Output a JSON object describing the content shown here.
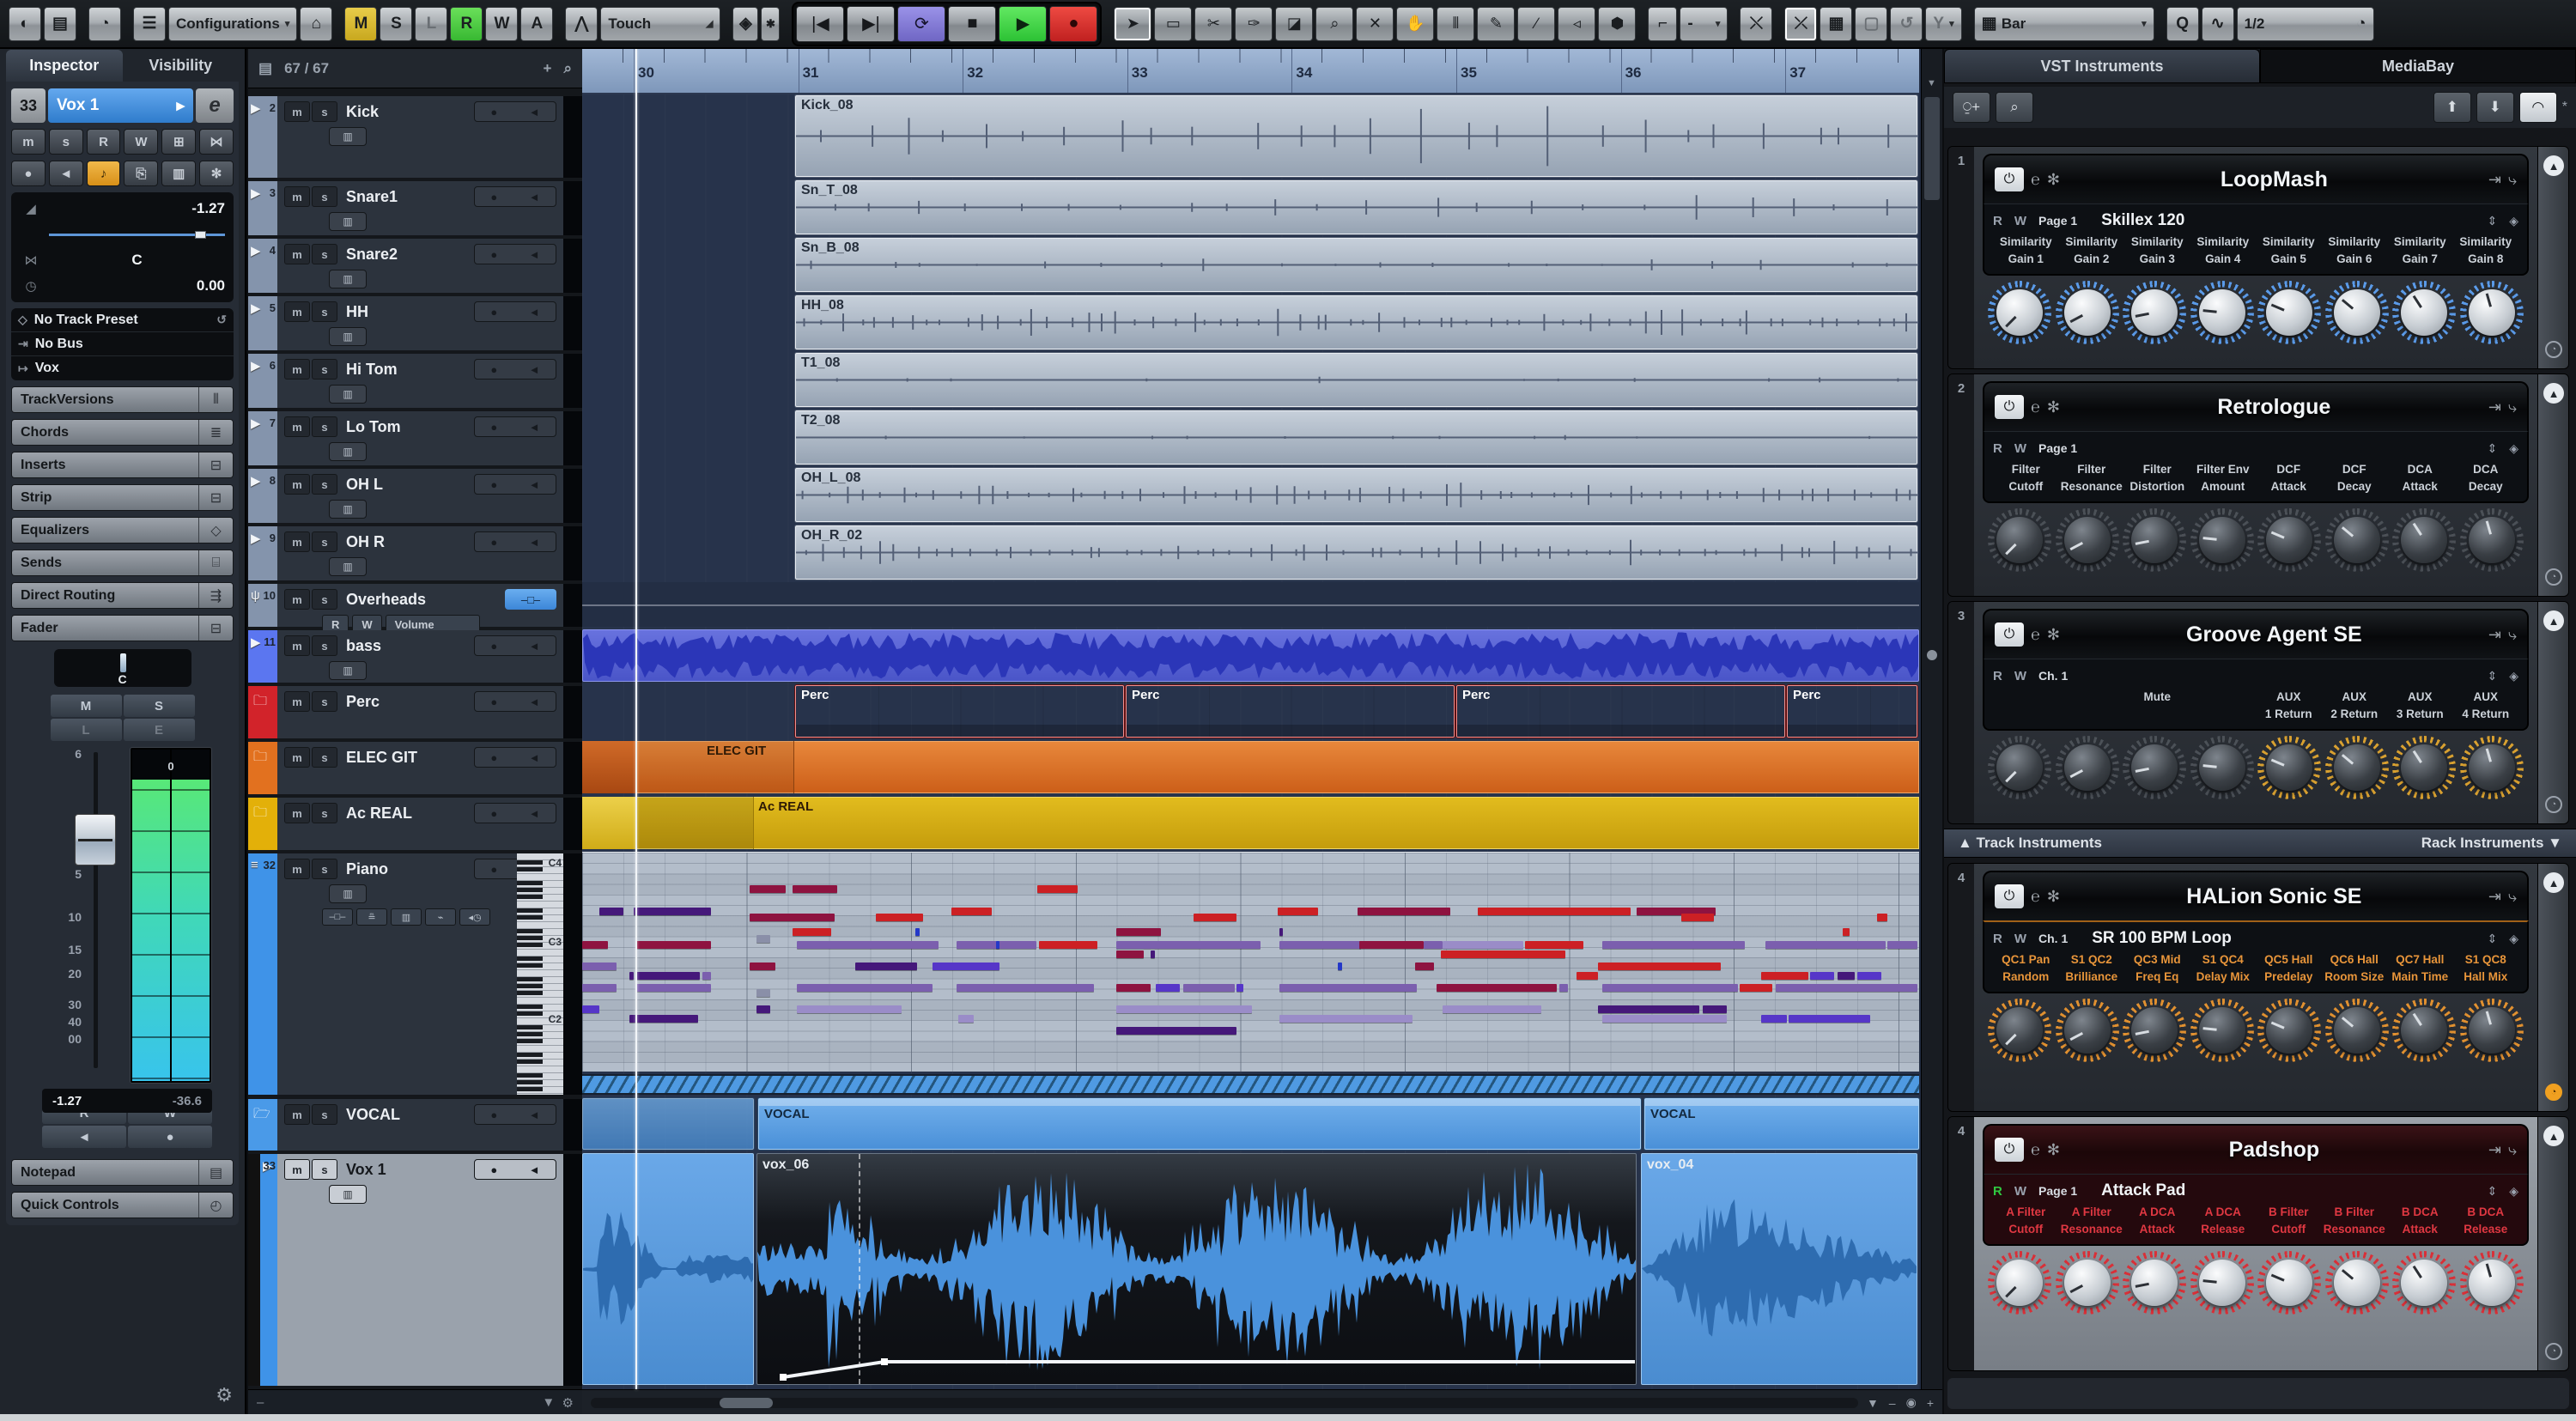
{
  "toolbar": {
    "configurations": "Configurations",
    "automation_mode": "Touch",
    "state_letters": [
      "M",
      "S",
      "L",
      "R",
      "W",
      "A"
    ],
    "grid_label": "Bar",
    "q_label": "Q",
    "quantize_label": "1/2",
    "snap_value": "-",
    "tools": [
      {
        "name": "object-selection",
        "glyph": "➤"
      },
      {
        "name": "range-selection",
        "glyph": "▭"
      },
      {
        "name": "split",
        "glyph": "✂"
      },
      {
        "name": "glue",
        "glyph": "✑"
      },
      {
        "name": "erase",
        "glyph": "◪"
      },
      {
        "name": "zoom",
        "glyph": "⌕"
      },
      {
        "name": "mute",
        "glyph": "✕"
      },
      {
        "name": "time-warp",
        "glyph": "✋"
      },
      {
        "name": "comp",
        "glyph": "⫴"
      },
      {
        "name": "draw",
        "glyph": "✎"
      },
      {
        "name": "line",
        "glyph": "∕"
      },
      {
        "name": "audition",
        "glyph": "◃"
      },
      {
        "name": "color",
        "glyph": "⬢"
      }
    ]
  },
  "inspector": {
    "tabs": [
      "Inspector",
      "Visibility"
    ],
    "track_number": "33",
    "track_name": "Vox 1",
    "edit_button": "e",
    "mute": "m",
    "solo": "s",
    "read": "R",
    "write": "W",
    "volume": "-1.27",
    "pan": "C",
    "delay": "0.00",
    "preset": "No Track Preset",
    "input": "No Bus",
    "output": "Vox",
    "sections": [
      {
        "label": "TrackVersions",
        "icon": "⫴"
      },
      {
        "label": "Chords",
        "icon": "≣"
      },
      {
        "label": "Inserts",
        "icon": "⊟"
      },
      {
        "label": "Strip",
        "icon": "⊟"
      },
      {
        "label": "Equalizers",
        "icon": "◇"
      },
      {
        "label": "Sends",
        "icon": "⌸"
      },
      {
        "label": "Direct Routing",
        "icon": "⇶"
      },
      {
        "label": "Fader",
        "icon": "⊟"
      }
    ],
    "fader": {
      "scale": [
        "6",
        "0",
        "5",
        "10",
        "15",
        "20",
        "30",
        "40",
        "00"
      ],
      "peak": "0",
      "value": "-1.27",
      "meter_value": "-36.6",
      "m": "M",
      "s": "S",
      "l": "L",
      "e": "E",
      "r": "R",
      "w": "W"
    },
    "bottom_sections": [
      {
        "label": "Notepad",
        "icon": "▤"
      },
      {
        "label": "Quick Controls",
        "icon": "◴"
      }
    ]
  },
  "track_list": {
    "count": "67 / 67",
    "m": "m",
    "s": "s",
    "tracks": [
      {
        "num": "2",
        "name": "Kick",
        "kind": "audio"
      },
      {
        "num": "3",
        "name": "Snare1",
        "kind": "audio"
      },
      {
        "num": "4",
        "name": "Snare2",
        "kind": "audio"
      },
      {
        "num": "5",
        "name": "HH",
        "kind": "audio"
      },
      {
        "num": "6",
        "name": "Hi Tom",
        "kind": "audio"
      },
      {
        "num": "7",
        "name": "Lo Tom",
        "kind": "audio"
      },
      {
        "num": "8",
        "name": "OH L",
        "kind": "audio"
      },
      {
        "num": "9",
        "name": "OH R",
        "kind": "audio"
      },
      {
        "num": "10",
        "name": "Overheads",
        "kind": "group",
        "automation": {
          "r": "R",
          "w": "W",
          "param": "Volume"
        }
      },
      {
        "num": "11",
        "name": "bass",
        "kind": "audio-blue"
      },
      {
        "num": "",
        "name": "Perc",
        "kind": "folder",
        "color": "#d2232a"
      },
      {
        "num": "",
        "name": "ELEC GIT",
        "kind": "folder",
        "color": "#e2711f"
      },
      {
        "num": "",
        "name": "Ac REAL",
        "kind": "folder",
        "color": "#e3b009"
      },
      {
        "num": "32",
        "name": "Piano",
        "kind": "instrument",
        "keys": [
          "C4",
          "C3",
          "C2"
        ]
      },
      {
        "num": "",
        "name": "VOCAL",
        "kind": "folder-open",
        "color": "#4a9ae8"
      },
      {
        "num": "33",
        "name": "Vox 1",
        "kind": "audio-selected"
      }
    ]
  },
  "arrange": {
    "bars": [
      "30",
      "31",
      "32",
      "33",
      "34",
      "35",
      "36",
      "37"
    ],
    "drum_events": [
      "Kick_08",
      "Sn_T_08",
      "Sn_B_08",
      "HH_08",
      "T1_08",
      "T2_08",
      "OH_L_08",
      "OH_R_02"
    ],
    "perc_events": [
      "Perc",
      "Perc",
      "Perc",
      "Perc"
    ],
    "elec_event": "ELEC GIT",
    "ac_event": "Ac REAL",
    "vocal_events": [
      "VOCAL",
      "VOCAL"
    ],
    "vox_events": [
      "vox_06",
      "vox_04"
    ],
    "midi_notes": [
      [
        195,
        38,
        42,
        "m"
      ],
      [
        245,
        38,
        52,
        "m"
      ],
      [
        530,
        38,
        47,
        "r"
      ],
      [
        20,
        64,
        28,
        "d"
      ],
      [
        60,
        64,
        90,
        "d"
      ],
      [
        430,
        64,
        47,
        "r"
      ],
      [
        810,
        64,
        47,
        "r"
      ],
      [
        903,
        64,
        108,
        "m"
      ],
      [
        1043,
        64,
        178,
        "r"
      ],
      [
        1228,
        64,
        92,
        "m"
      ],
      [
        195,
        71,
        99,
        "m"
      ],
      [
        342,
        71,
        55,
        "r"
      ],
      [
        712,
        71,
        50,
        "r"
      ],
      [
        1280,
        71,
        38,
        "r"
      ],
      [
        1508,
        71,
        12,
        "r"
      ],
      [
        245,
        88,
        45,
        "r"
      ],
      [
        388,
        88,
        5,
        "b"
      ],
      [
        622,
        88,
        52,
        "m"
      ],
      [
        812,
        88,
        4,
        "d"
      ],
      [
        1468,
        88,
        8,
        "r"
      ],
      [
        203,
        96,
        16,
        "g"
      ],
      [
        0,
        103,
        30,
        "m"
      ],
      [
        62,
        103,
        88,
        "m"
      ],
      [
        250,
        103,
        165,
        "p"
      ],
      [
        436,
        103,
        93,
        "p"
      ],
      [
        482,
        103,
        4,
        "b"
      ],
      [
        532,
        103,
        68,
        "r"
      ],
      [
        622,
        103,
        168,
        "p"
      ],
      [
        812,
        103,
        95,
        "p"
      ],
      [
        905,
        103,
        75,
        "m"
      ],
      [
        980,
        103,
        22,
        "p"
      ],
      [
        1002,
        103,
        94,
        "lv"
      ],
      [
        1098,
        103,
        68,
        "r"
      ],
      [
        1188,
        103,
        166,
        "p"
      ],
      [
        1378,
        103,
        140,
        "p"
      ],
      [
        1520,
        103,
        35,
        "p"
      ],
      [
        622,
        114,
        32,
        "m"
      ],
      [
        662,
        114,
        5,
        "d"
      ],
      [
        1000,
        114,
        145,
        "r"
      ],
      [
        0,
        128,
        40,
        "p"
      ],
      [
        195,
        128,
        30,
        "m"
      ],
      [
        318,
        128,
        72,
        "d"
      ],
      [
        408,
        128,
        78,
        "v"
      ],
      [
        880,
        128,
        5,
        "b"
      ],
      [
        970,
        128,
        22,
        "m"
      ],
      [
        1183,
        128,
        143,
        "r"
      ],
      [
        55,
        139,
        5,
        "d"
      ],
      [
        62,
        139,
        75,
        "d"
      ],
      [
        140,
        139,
        10,
        "p"
      ],
      [
        1158,
        139,
        25,
        "r"
      ],
      [
        1373,
        139,
        55,
        "r"
      ],
      [
        1430,
        139,
        28,
        "v"
      ],
      [
        1462,
        139,
        20,
        "d"
      ],
      [
        1485,
        139,
        28,
        "v"
      ],
      [
        0,
        153,
        40,
        "p"
      ],
      [
        62,
        153,
        88,
        "p"
      ],
      [
        250,
        153,
        158,
        "p"
      ],
      [
        436,
        153,
        160,
        "p"
      ],
      [
        622,
        153,
        40,
        "m"
      ],
      [
        668,
        153,
        28,
        "v"
      ],
      [
        700,
        153,
        60,
        "p"
      ],
      [
        762,
        153,
        8,
        "v"
      ],
      [
        812,
        153,
        160,
        "p"
      ],
      [
        995,
        153,
        140,
        "m"
      ],
      [
        1138,
        153,
        10,
        "p"
      ],
      [
        1188,
        153,
        158,
        "p"
      ],
      [
        1348,
        153,
        38,
        "r"
      ],
      [
        1390,
        153,
        165,
        "p"
      ],
      [
        203,
        159,
        16,
        "g"
      ],
      [
        0,
        178,
        20,
        "v"
      ],
      [
        203,
        178,
        16,
        "d"
      ],
      [
        250,
        178,
        122,
        "lv"
      ],
      [
        622,
        178,
        158,
        "lv"
      ],
      [
        1002,
        178,
        115,
        "lv"
      ],
      [
        1183,
        178,
        118,
        "d"
      ],
      [
        1305,
        178,
        28,
        "d"
      ],
      [
        55,
        189,
        80,
        "d"
      ],
      [
        438,
        189,
        18,
        "lv"
      ],
      [
        812,
        189,
        155,
        "lv"
      ],
      [
        1188,
        189,
        145,
        "lv"
      ],
      [
        1373,
        189,
        30,
        "v"
      ],
      [
        1405,
        189,
        95,
        "v"
      ],
      [
        622,
        203,
        140,
        "d"
      ]
    ]
  },
  "rack": {
    "tabs": [
      "VST Instruments",
      "MediaBay"
    ],
    "divider": {
      "left": "Track Instruments",
      "right": "Rack Instruments"
    },
    "slots": [
      {
        "num": "1",
        "title": "LoopMash",
        "r": "R",
        "w": "W",
        "page": "Page 1",
        "preset": "Skillex 120",
        "theme": "blue",
        "labels": [
          "Similarity|Gain 1",
          "Similarity|Gain 2",
          "Similarity|Gain 3",
          "Similarity|Gain 4",
          "Similarity|Gain 5",
          "Similarity|Gain 6",
          "Similarity|Gain 7",
          "Similarity|Gain 8"
        ]
      },
      {
        "num": "2",
        "title": "Retrologue",
        "r": "R",
        "w": "W",
        "page": "Page 1",
        "preset": "",
        "theme": "dark",
        "labels": [
          "Filter|Cutoff",
          "Filter|Resonance",
          "Filter|Distortion",
          "Filter Env|Amount",
          "DCF|Attack",
          "DCF|Decay",
          "DCA|Attack",
          "DCA|Decay"
        ]
      },
      {
        "num": "3",
        "title": "Groove Agent SE",
        "r": "R",
        "w": "W",
        "page": "Ch. 1",
        "preset": "",
        "theme": "amber",
        "labels": [
          "",
          "",
          "Mute",
          "",
          "AUX|1 Return",
          "AUX|2 Return",
          "AUX|3 Return",
          "AUX|4 Return"
        ]
      },
      {
        "num": "4",
        "title": "HALion Sonic SE",
        "r": "R",
        "w": "W",
        "page": "Ch. 1",
        "preset": "SR 100 BPM Loop",
        "theme": "orange",
        "labels": [
          "QC1 Pan|Random",
          "S1 QC2|Brilliance",
          "QC3 Mid|Freq Eq",
          "S1 QC4|Delay Mix",
          "QC5 Hall|Predelay",
          "QC6 Hall|Room Size",
          "QC7 Hall|Main Time",
          "S1 QC8|Hall Mix"
        ]
      },
      {
        "num": "4",
        "title": "Padshop",
        "r": "R",
        "w": "W",
        "page": "Page 1",
        "preset": "Attack Pad",
        "theme": "red",
        "labels": [
          "A Filter|Cutoff",
          "A Filter|Resonance",
          "A DCA|Attack",
          "A DCA|Release",
          "B Filter|Cutoff",
          "B Filter|Resonance",
          "B DCA|Attack",
          "B DCA|Release"
        ]
      }
    ]
  },
  "colors": {
    "accent_blue": "#4a90d8",
    "perc_red": "#d02a2c",
    "elec_orange": "#e0762c",
    "ac_yellow": "#d8ae14",
    "play_green": "#35d045",
    "rec_red": "#e03030",
    "loop_purple": "#8a82d8",
    "note_red": "#cc2024",
    "note_maroon": "#8e1340",
    "note_purple": "#7b5fae",
    "note_darkpurple": "#45187a",
    "note_violet": "#5636c8",
    "note_lavender": "#9a8cc8",
    "note_grey": "#8a8fa8",
    "note_blue": "#2438c8"
  }
}
